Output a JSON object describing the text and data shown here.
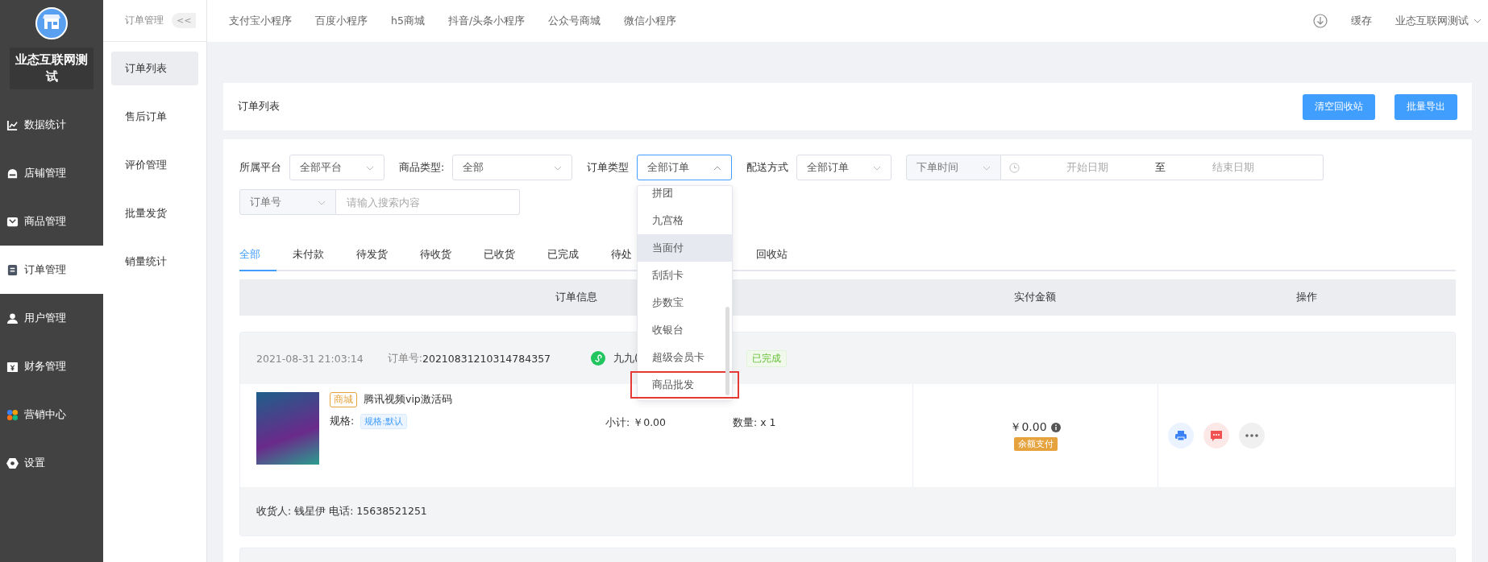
{
  "sidebar": {
    "store_name": "业态互联网测试",
    "items": [
      {
        "label": "数据统计",
        "kind": "chart",
        "selected": false
      },
      {
        "label": "店铺管理",
        "kind": "store",
        "selected": false
      },
      {
        "label": "商品管理",
        "kind": "bag",
        "selected": false
      },
      {
        "label": "订单管理",
        "kind": "clipboard",
        "selected": true
      },
      {
        "label": "用户管理",
        "kind": "user",
        "selected": false
      },
      {
        "label": "财务管理",
        "kind": "yen",
        "selected": false
      },
      {
        "label": "营销中心",
        "kind": "petals",
        "selected": false
      },
      {
        "label": "设置",
        "kind": "hexagon",
        "selected": false
      }
    ]
  },
  "submenu": {
    "title": "订单管理",
    "collapse": "<<",
    "items": [
      {
        "label": "订单列表",
        "selected": true
      },
      {
        "label": "售后订单",
        "selected": false
      },
      {
        "label": "评价管理",
        "selected": false
      },
      {
        "label": "批量发货",
        "selected": false
      },
      {
        "label": "销量统计",
        "selected": false
      }
    ]
  },
  "top_nav": {
    "links": [
      "支付宝小程序",
      "百度小程序",
      "h5商城",
      "抖音/头条小程序",
      "公众号商城",
      "微信小程序"
    ],
    "cache": "缓存",
    "account": "业态互联网测试"
  },
  "title_card": {
    "title": "订单列表",
    "buttons": [
      "清空回收站",
      "批量导出"
    ]
  },
  "filters": {
    "platform": {
      "label": "所属平台",
      "value": "全部平台"
    },
    "goods_type": {
      "label": "商品类型:",
      "value": "全部"
    },
    "order_type": {
      "label": "订单类型",
      "value": "全部订单",
      "expanded": true,
      "options": [
        {
          "label": "拼团",
          "hovered": false,
          "marked": false
        },
        {
          "label": "九宫格",
          "hovered": false,
          "marked": false
        },
        {
          "label": "当面付",
          "hovered": true,
          "marked": false
        },
        {
          "label": "刮刮卡",
          "hovered": false,
          "marked": false
        },
        {
          "label": "步数宝",
          "hovered": false,
          "marked": false
        },
        {
          "label": "收银台",
          "hovered": false,
          "marked": false
        },
        {
          "label": "超级会员卡",
          "hovered": false,
          "marked": false
        },
        {
          "label": "商品批发",
          "hovered": false,
          "marked": true
        }
      ]
    },
    "delivery": {
      "label": "配送方式",
      "value": "全部订单"
    },
    "time": {
      "value": "下单时间",
      "start_placeholder": "开始日期",
      "separator": "至",
      "end_placeholder": "结束日期"
    },
    "search": {
      "field": "订单号",
      "placeholder": "请输入搜索内容"
    }
  },
  "tabs": [
    {
      "label": "全部",
      "selected": true,
      "cut": false
    },
    {
      "label": "未付款",
      "selected": false,
      "cut": false
    },
    {
      "label": "待发货",
      "selected": false,
      "cut": false
    },
    {
      "label": "待收货",
      "selected": false,
      "cut": false
    },
    {
      "label": "已收货",
      "selected": false,
      "cut": false
    },
    {
      "label": "已完成",
      "selected": false,
      "cut": false
    },
    {
      "label": "待处",
      "selected": false,
      "cut": true
    },
    {
      "label": "回收站",
      "selected": false,
      "cut": false
    }
  ],
  "table": {
    "columns": [
      "订单信息",
      "实付金额",
      "操作"
    ]
  },
  "order": {
    "time": "2021-08-31 21:03:14",
    "number_label": "订单号:",
    "number": "20210831210314784357",
    "source": "九九(",
    "source_cut": true,
    "status": "已完成",
    "product": {
      "tag": "商城",
      "name": "腾讯视频vip激活码",
      "spec_label": "规格:",
      "spec": "规格:默认",
      "subtotal": "小计: ￥0.00",
      "quantity": "数量: x 1"
    },
    "amount": "￥0.00",
    "payment": "余额支付",
    "footer": "收货人: 钱星伊 电话: 15638521251"
  }
}
